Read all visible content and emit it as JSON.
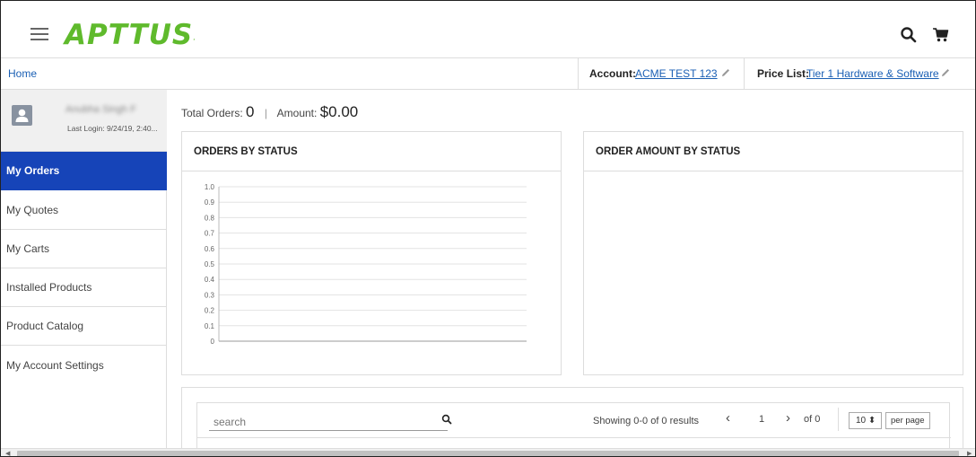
{
  "header": {
    "logo": "APTTUS",
    "logo_mark": "·"
  },
  "nav": {
    "home": "Home",
    "account_label": "Account:",
    "account_value": "ACME TEST 123",
    "pricelist_label": "Price List:",
    "pricelist_value": "Tier 1 Hardware & Software"
  },
  "profile": {
    "name": "Anubha Singh F",
    "last_login": "Last Login: 9/24/19, 2:40..."
  },
  "sidebar": {
    "items": [
      {
        "label": "My Orders",
        "active": true
      },
      {
        "label": "My Quotes"
      },
      {
        "label": "My Carts"
      },
      {
        "label": "Installed Products"
      },
      {
        "label": "Product Catalog"
      },
      {
        "label": "My Account Settings"
      }
    ]
  },
  "summary": {
    "total_orders_label": "Total Orders:",
    "total_orders_value": "0",
    "separator": "|",
    "amount_label": "Amount:",
    "amount_value": "$0.00"
  },
  "cards": {
    "orders_by_status": "ORDERS BY STATUS",
    "order_amount_by_status": "ORDER AMOUNT BY STATUS"
  },
  "chart_data": {
    "type": "bar",
    "title": "ORDERS BY STATUS",
    "categories": [],
    "values": [],
    "ylim": [
      0,
      1.0
    ],
    "yticks": [
      "1.0",
      "0.9",
      "0.8",
      "0.7",
      "0.6",
      "0.5",
      "0.4",
      "0.3",
      "0.2",
      "0.1",
      "0"
    ],
    "grid": true
  },
  "table": {
    "search_placeholder": "search",
    "showing": "Showing 0-0 of 0 results",
    "prev": "‹",
    "page": "1",
    "next": "›",
    "of": "of 0",
    "per_page_value": "10 ⬍",
    "per_page_label": "per page"
  },
  "colors": {
    "brand_green": "#5fba2c",
    "active_blue": "#1644b8",
    "link_blue": "#1a5fb4"
  },
  "icons": {
    "menu": "hamburger-icon",
    "search": "search-icon",
    "cart": "cart-icon",
    "edit": "pencil-icon",
    "user": "user-icon"
  }
}
